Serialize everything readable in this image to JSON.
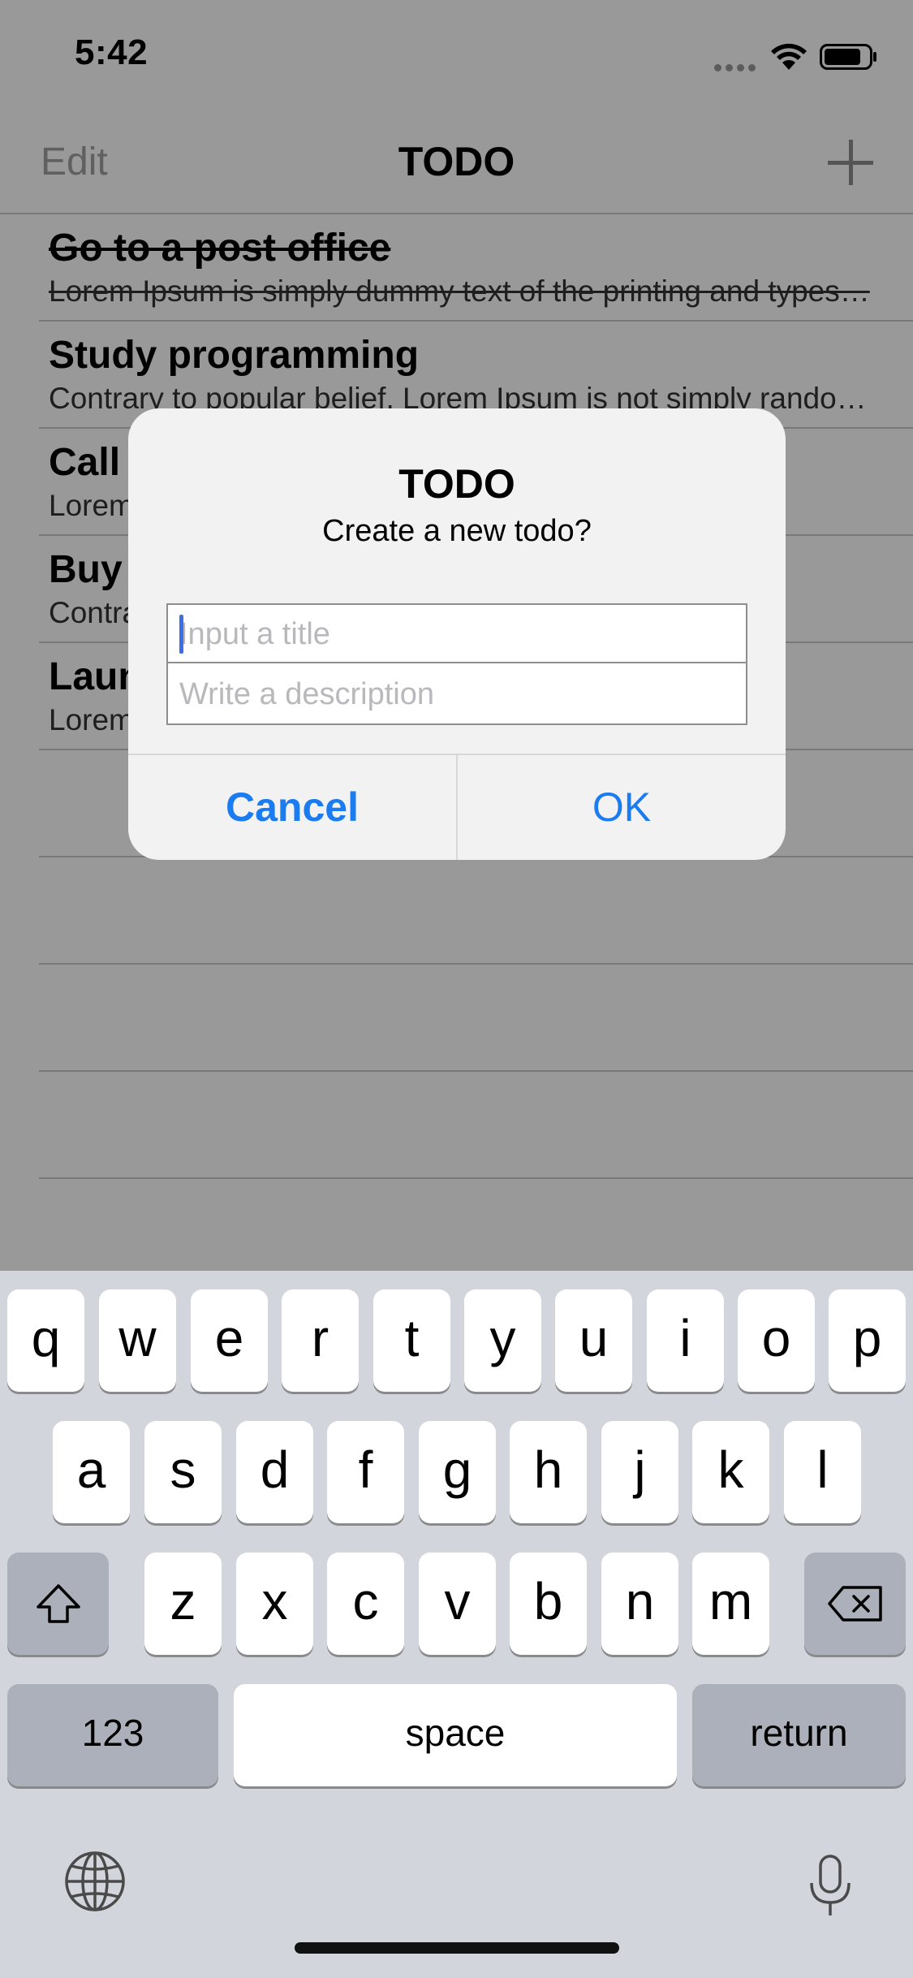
{
  "status_bar": {
    "time": "5:42"
  },
  "nav": {
    "edit_label": "Edit",
    "title": "TODO",
    "add_icon": "plus-icon"
  },
  "todos": [
    {
      "title": "Go to a post office",
      "description": "Lorem Ipsum is simply dummy text of the printing and types…",
      "done": true
    },
    {
      "title": "Study programming",
      "description": "Contrary to popular belief, Lorem Ipsum is not simply rando…",
      "done": false
    },
    {
      "title": "Call",
      "description": "Lorem",
      "done": false
    },
    {
      "title": "Buy",
      "description": "Contra",
      "done": false
    },
    {
      "title": "Laun",
      "description": "Lorem",
      "done": false
    }
  ],
  "alert": {
    "title": "TODO",
    "message": "Create a new todo?",
    "title_placeholder": "Input a title",
    "description_placeholder": "Write a description",
    "cancel_label": "Cancel",
    "ok_label": "OK",
    "button_color": "#1a7cf0"
  },
  "keyboard": {
    "row1": [
      "q",
      "w",
      "e",
      "r",
      "t",
      "y",
      "u",
      "i",
      "o",
      "p"
    ],
    "row2": [
      "a",
      "s",
      "d",
      "f",
      "g",
      "h",
      "j",
      "k",
      "l"
    ],
    "row3": [
      "z",
      "x",
      "c",
      "v",
      "b",
      "n",
      "m"
    ],
    "num_label": "123",
    "space_label": "space",
    "return_label": "return",
    "shift_icon": "shift-icon",
    "delete_icon": "delete-icon",
    "globe_icon": "globe-icon",
    "mic_icon": "microphone-icon"
  }
}
